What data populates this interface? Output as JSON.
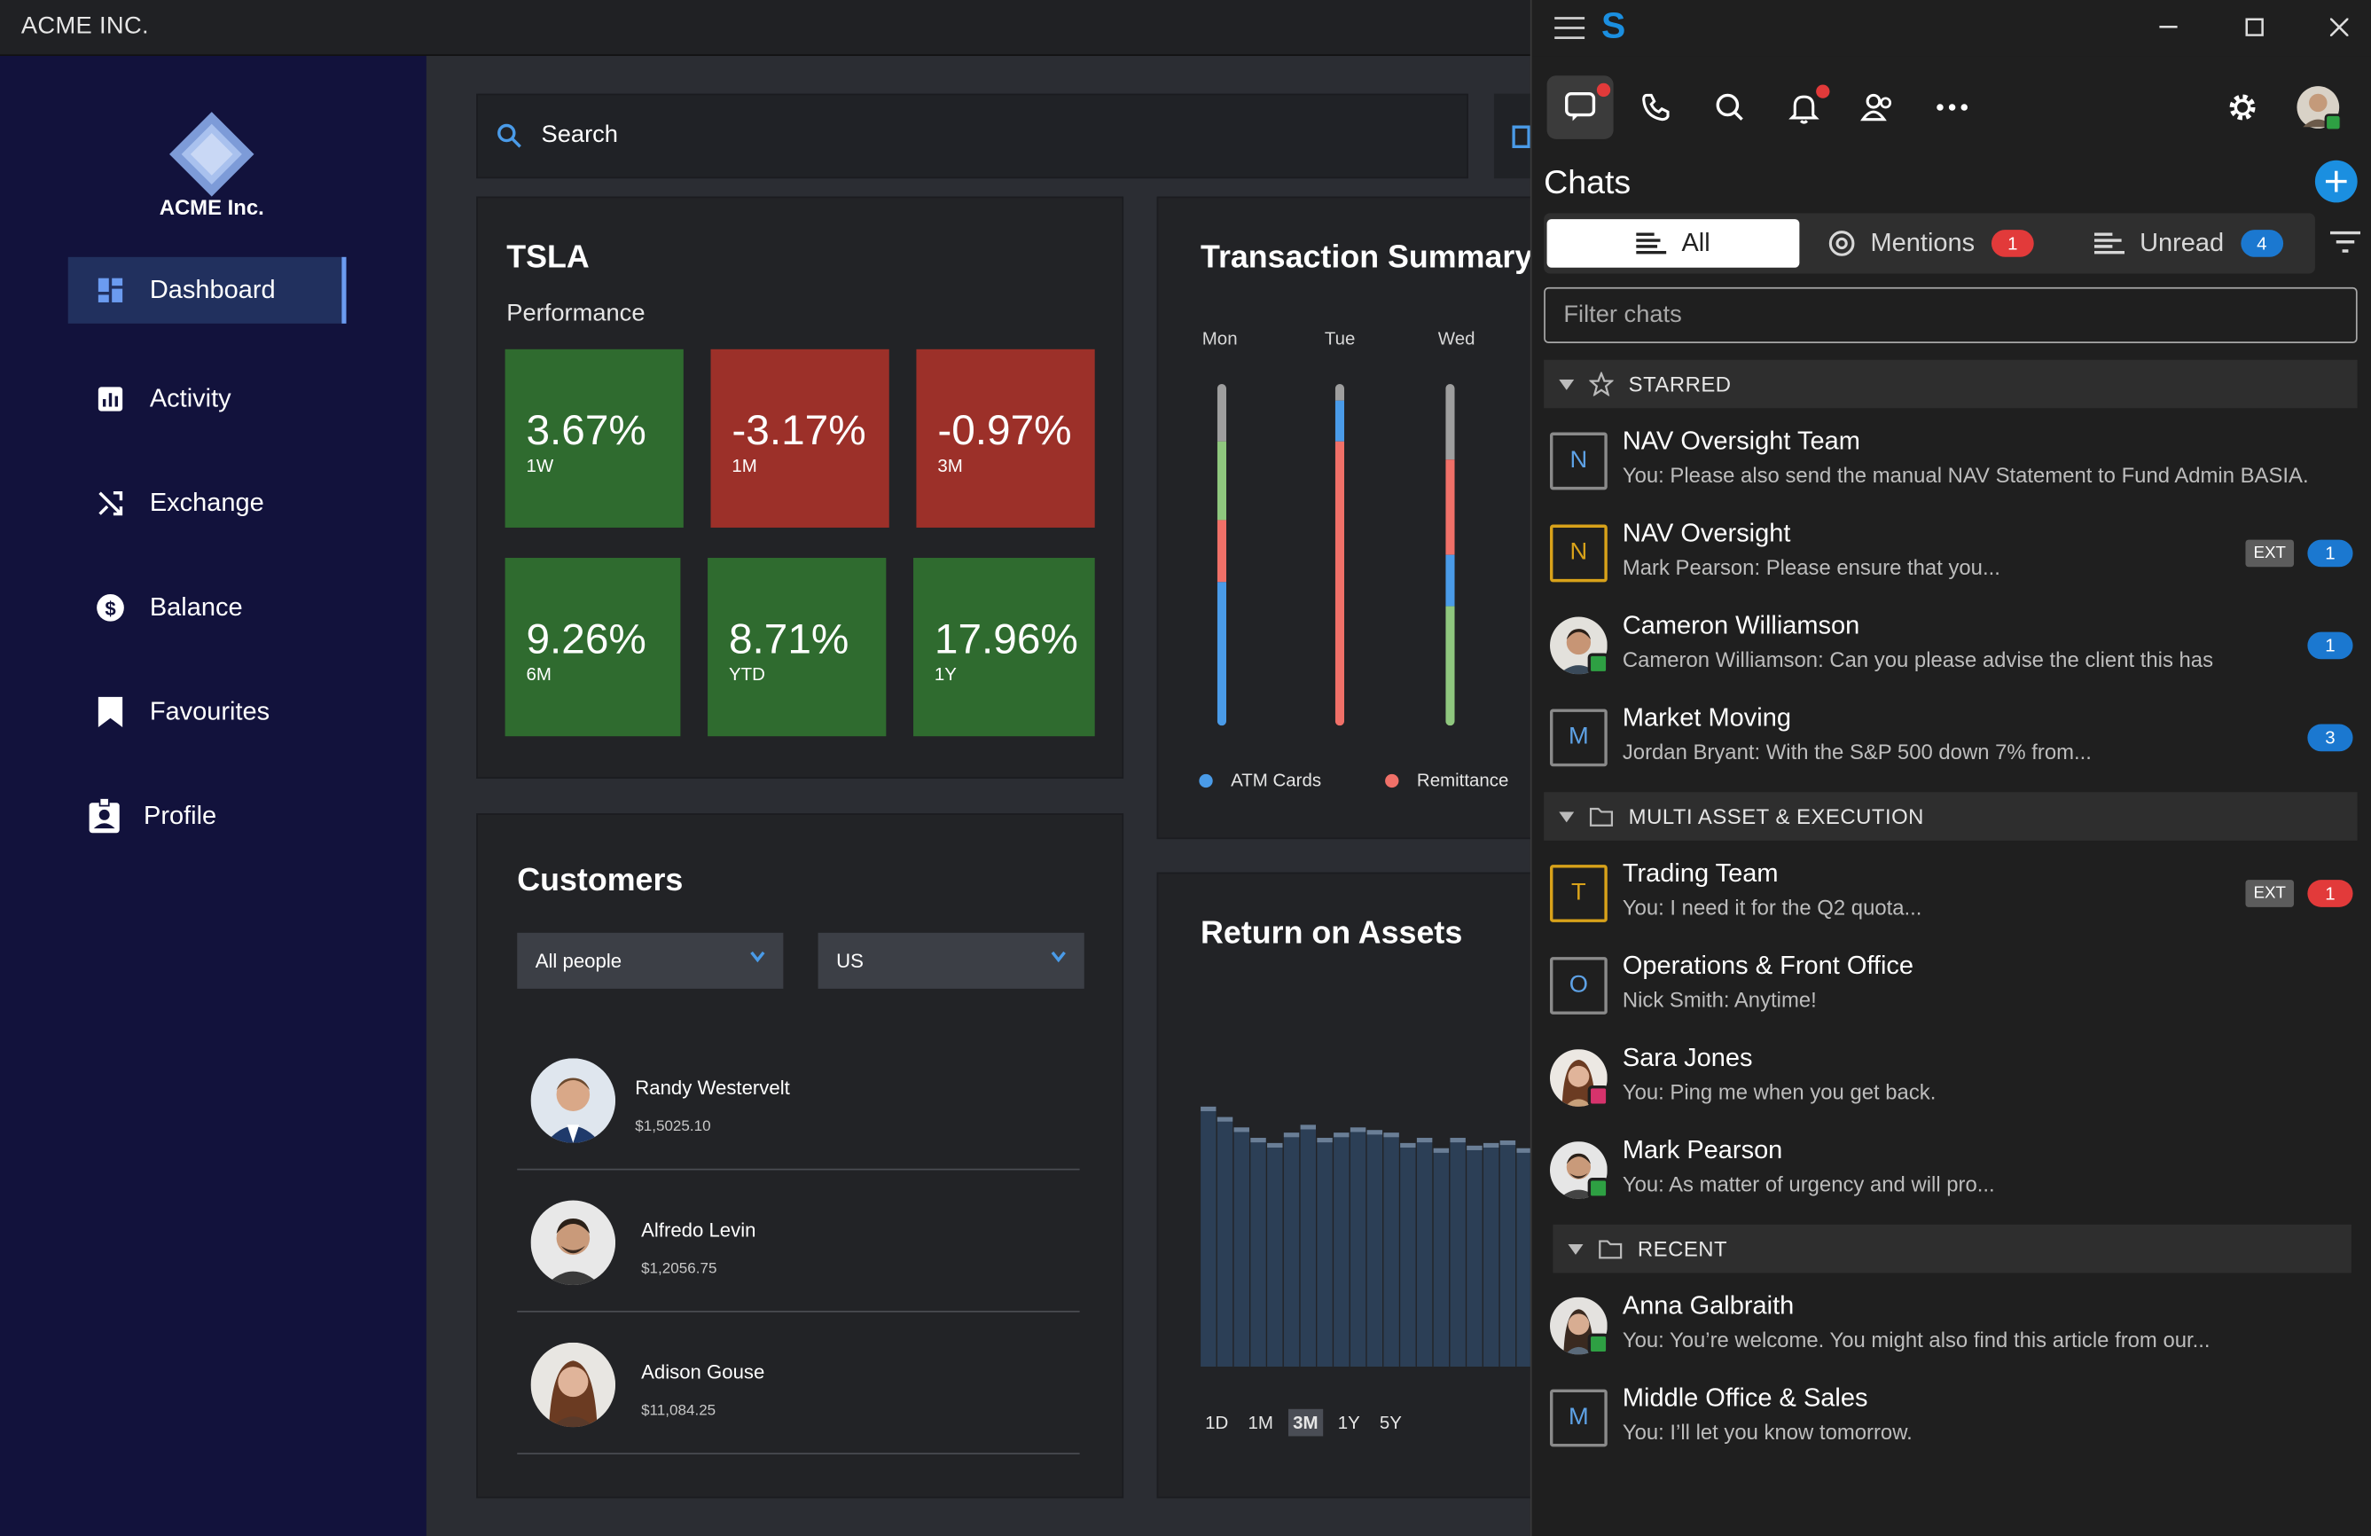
{
  "window": {
    "title": "ACME INC."
  },
  "sidebar": {
    "logo_text": "ACME Inc.",
    "items": [
      {
        "label": "Dashboard",
        "icon": "dashboard-icon",
        "active": true
      },
      {
        "label": "Activity",
        "icon": "bar-chart-icon"
      },
      {
        "label": "Exchange",
        "icon": "shuffle-icon"
      },
      {
        "label": "Balance",
        "icon": "dollar-circle-icon"
      },
      {
        "label": "Favourites",
        "icon": "bookmark-icon"
      },
      {
        "label": "Profile",
        "icon": "profile-badge-icon"
      }
    ]
  },
  "search": {
    "placeholder": "Search"
  },
  "tsla": {
    "title": "TSLA",
    "subtitle": "Performance",
    "tiles": [
      {
        "value": "3.67%",
        "period": "1W",
        "color": "#2f6b2f"
      },
      {
        "value": "-3.17%",
        "period": "1M",
        "color": "#9c3029"
      },
      {
        "value": "-0.97%",
        "period": "3M",
        "color": "#9c3029"
      },
      {
        "value": "9.26%",
        "period": "6M",
        "color": "#2f6b2f"
      },
      {
        "value": "8.71%",
        "period": "YTD",
        "color": "#2f6b2f"
      },
      {
        "value": "17.96%",
        "period": "1Y",
        "color": "#2f6b2f"
      }
    ]
  },
  "transactions": {
    "title": "Transaction Summary",
    "days": [
      "Mon",
      "Tue",
      "Wed"
    ],
    "legend": [
      {
        "label": "ATM Cards",
        "color": "#4a9be8"
      },
      {
        "label": "Remittance",
        "color": "#f07068"
      }
    ],
    "segments": {
      "Mon": [
        {
          "color": "#9e9e9e",
          "value": 0.17
        },
        {
          "color": "#8fc77e",
          "value": 0.23
        },
        {
          "color": "#f07068",
          "value": 0.18
        },
        {
          "color": "#4a9be8",
          "value": 0.42
        }
      ],
      "Tue": [
        {
          "color": "#9e9e9e",
          "value": 0.05
        },
        {
          "color": "#4a9be8",
          "value": 0.12
        },
        {
          "color": "#f07068",
          "value": 0.83
        }
      ],
      "Wed": [
        {
          "color": "#9e9e9e",
          "value": 0.22
        },
        {
          "color": "#f07068",
          "value": 0.28
        },
        {
          "color": "#4a9be8",
          "value": 0.15
        },
        {
          "color": "#8fc77e",
          "value": 0.35
        }
      ]
    }
  },
  "customers": {
    "title": "Customers",
    "filter_people": "All people",
    "filter_region": "US",
    "rows": [
      {
        "name": "Randy Westervelt",
        "amount": "$1,5025.10"
      },
      {
        "name": "Alfredo Levin",
        "amount": "$1,2056.75"
      },
      {
        "name": "Adison Gouse",
        "amount": "$11,084.25"
      }
    ]
  },
  "roa": {
    "title": "Return on Assets",
    "ranges": [
      "1D",
      "1M",
      "3M",
      "1Y",
      "5Y"
    ],
    "selected_range": "3M",
    "bar_fraction": [
      1.0,
      0.96,
      0.92,
      0.88,
      0.86,
      0.9,
      0.93,
      0.88,
      0.9,
      0.92,
      0.91,
      0.9,
      0.86,
      0.88,
      0.84,
      0.88,
      0.85,
      0.86,
      0.87,
      0.84,
      0.8
    ]
  },
  "chat": {
    "app_logo": "S",
    "title": "Chats",
    "tabs": {
      "all": "All",
      "mentions": "Mentions",
      "mentions_count": "1",
      "unread": "Unread",
      "unread_count": "4"
    },
    "filter_placeholder": "Filter chats",
    "sections": [
      {
        "label": "STARRED",
        "icon": "star-icon"
      },
      {
        "label": "MULTI ASSET & EXECUTION",
        "icon": "folder-icon"
      },
      {
        "label": "RECENT",
        "icon": "folder-icon"
      }
    ],
    "rows": [
      {
        "name": "NAV Oversight Team",
        "preview": "You: Please also send the manual NAV Statement to Fund Admin BASIA.",
        "avatar": "N",
        "style": "letter-grey"
      },
      {
        "name": "NAV Oversight",
        "preview": "Mark Pearson: Please ensure that you...",
        "avatar": "N",
        "style": "letter-gold",
        "ext": "EXT",
        "count": "1",
        "count_color": "#1b78d0"
      },
      {
        "name": "Cameron Williamson",
        "preview": "Cameron Williamson: Can you please advise the client this has",
        "avatar": "photo",
        "status": "#2ea043",
        "count": "1",
        "count_color": "#1b78d0"
      },
      {
        "name": "Market Moving",
        "preview": "Jordan Bryant: With the S&P 500 down 7% from...",
        "avatar": "M",
        "style": "letter-grey",
        "count": "3",
        "count_color": "#1b78d0"
      },
      {
        "name": "Trading Team",
        "preview": "You: I need it for the Q2 quota...",
        "avatar": "T",
        "style": "letter-gold",
        "ext": "EXT",
        "count": "1",
        "count_color": "#e23a3a"
      },
      {
        "name": "Operations & Front Office",
        "preview": "Nick Smith: Anytime!",
        "avatar": "O",
        "style": "letter-grey"
      },
      {
        "name": "Sara Jones",
        "preview": "You: Ping me when you get back.",
        "avatar": "photo",
        "status": "#d6336c"
      },
      {
        "name": "Mark Pearson",
        "preview": "You: As matter of urgency and will pro...",
        "avatar": "photo",
        "status": "#2ea043"
      },
      {
        "name": "Anna Galbraith",
        "preview": "You: You’re welcome. You might also find this article from our...",
        "avatar": "photo",
        "status": "#2ea043"
      },
      {
        "name": "Middle Office & Sales",
        "preview": "You: I’ll let you know tomorrow.",
        "avatar": "M",
        "style": "letter-grey"
      }
    ]
  }
}
